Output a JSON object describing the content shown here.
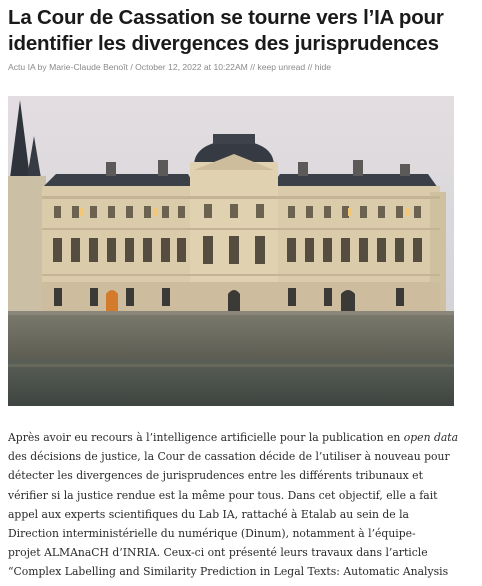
{
  "article": {
    "title": "La Cour de Cassation se tourne vers l’IA pour identifier les divergences des jurisprudences",
    "meta": {
      "category": "Actu IA",
      "by": "by",
      "author": "Marie-Claude Benoît",
      "separator": "/",
      "date": "October 12, 2022 at 10:22AM",
      "divider": "//",
      "keep_unread": "keep unread",
      "hide": "hide"
    },
    "hero_image": {
      "icon": "palais-de-justice-photo",
      "sky_color": "#d9d6d8",
      "stone_color": "#d9c9aa",
      "roof_color": "#3b4049",
      "water_color": "#4c524f"
    },
    "body": {
      "line1_before_em": "Après avoir eu recours à l’intelligence artificielle pour la publication en ",
      "line1_em": "open data",
      "line2": "des décisions de justice, la Cour de cassation décide de l’utiliser à nouveau pour",
      "line3": "détecter les divergences de jurisprudences entre les différents tribunaux et",
      "line4": "vérifier si la justice rendue est la même pour tous. Dans cet objectif, elle a fait",
      "line5": "appel aux experts scientifiques du Lab IA, rattaché à Etalab au sein de la",
      "line6": "Direction interministérielle du numérique (Dinum), notamment à l’équipe-",
      "line7": "projet ALMAnaCH d’INRIA. Ceux-ci ont présenté leurs travaux dans l’article",
      "line8": "“Complex Labelling and Similarity Prediction in Legal Texts: Automatic Analysis"
    }
  }
}
